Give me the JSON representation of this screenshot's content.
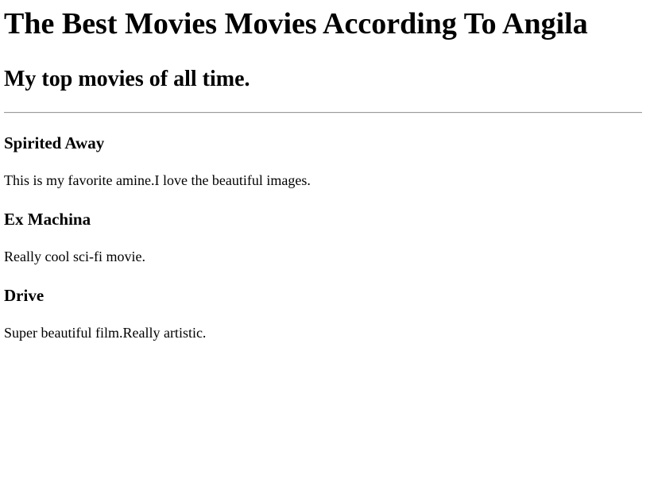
{
  "page": {
    "title": "The Best Movies Movies According To Angila",
    "subtitle": "My top movies of all time."
  },
  "movies": [
    {
      "name": "Spirited Away",
      "description": "This is my favorite amine.I love the beautiful images."
    },
    {
      "name": "Ex Machina",
      "description": "Really cool sci-fi movie."
    },
    {
      "name": "Drive",
      "description": "Super beautiful film.Really artistic."
    }
  ]
}
